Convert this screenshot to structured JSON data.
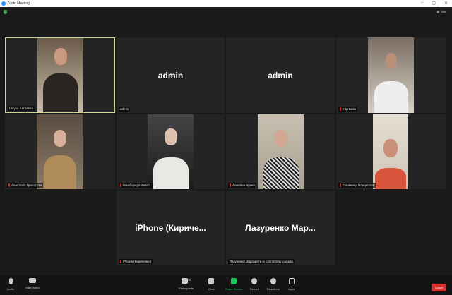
{
  "window": {
    "title": "Zoom Meeting",
    "minimize": "–",
    "maximize": "▢",
    "close": "✕"
  },
  "top": {
    "view_label": "View"
  },
  "participants": [
    {
      "name": "Larysa Karpenko",
      "video": true,
      "muted": false,
      "active": true
    },
    {
      "name": "admin",
      "display": "admin",
      "video": false,
      "muted": false
    },
    {
      "name": "",
      "display": "admin",
      "video": false,
      "muted": false
    },
    {
      "name": "Ігор Бевз",
      "video": true,
      "muted": true
    },
    {
      "name": "Анастасія Григор'єва",
      "video": true,
      "muted": true
    },
    {
      "name": "Мамборода Анаст...",
      "video": true,
      "muted": true
    },
    {
      "name": "Ангеліна Бужко",
      "video": true,
      "muted": true
    },
    {
      "name": "Свєженць Владислав",
      "video": true,
      "muted": true
    },
    {
      "name": "iPhone (Кириченко)",
      "display": "iPhone  (Киричe...",
      "video": false,
      "muted": true
    },
    {
      "name": "Лазуренко Маргарита is connecting to audio",
      "display": "Лазуренко  Мар...",
      "video": false,
      "muted": false
    }
  ],
  "toolbar": {
    "audio": "Audio",
    "start_video": "Start Video",
    "participants": "Participants",
    "participants_count": "10",
    "chat": "Chat",
    "share_screen": "Share Screen",
    "record": "Record",
    "reactions": "Reactions",
    "apps": "Apps",
    "leave": "Leave"
  },
  "colors": {
    "share": "#22c55e",
    "leave": "#d12e2e",
    "active_border": "#c7d98a"
  }
}
